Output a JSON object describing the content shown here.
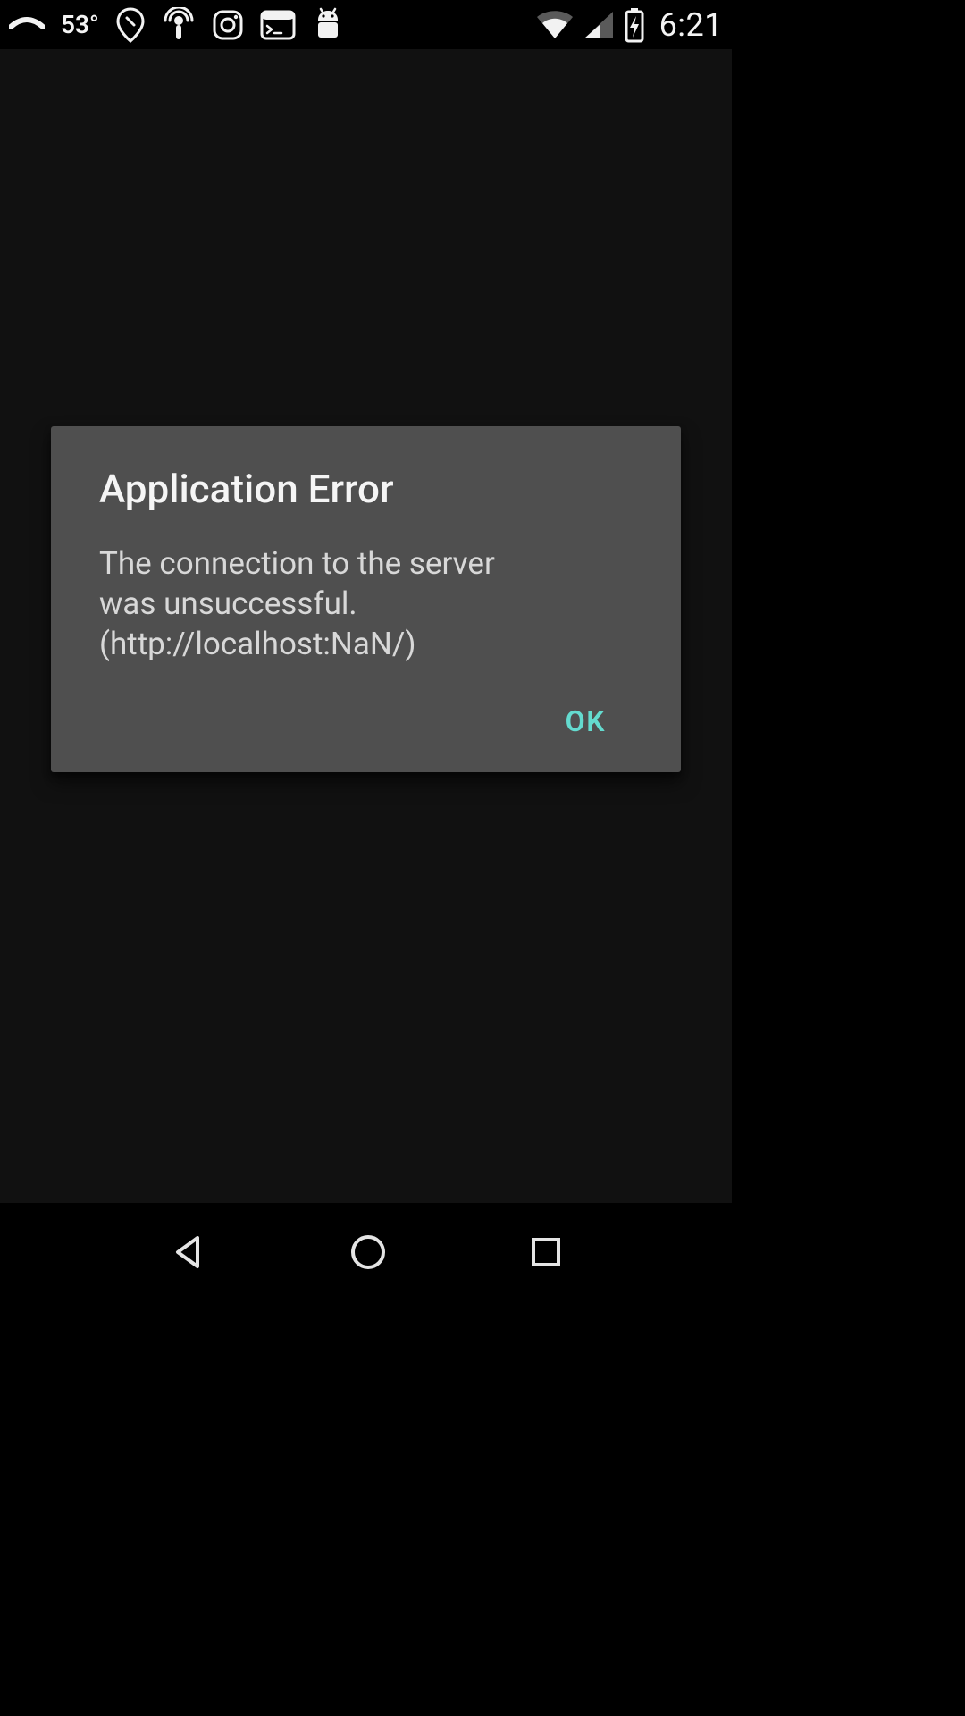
{
  "status_bar": {
    "temperature": "53°",
    "time": "6:21",
    "icons": {
      "signal_arc": "signal-arc-icon",
      "location": "location-icon",
      "podcast": "podcast-icon",
      "instagram": "instagram-icon",
      "terminal": "terminal-icon",
      "android": "android-icon",
      "wifi": "wifi-icon",
      "cell": "cell-signal-icon",
      "battery": "battery-charging-icon"
    }
  },
  "dialog": {
    "title": "Application Error",
    "message": "The connection to the server was unsuccessful. (http://localhost:NaN/)",
    "ok_label": "OK"
  },
  "nav_bar": {
    "back": "back",
    "home": "home",
    "recents": "recents"
  },
  "colors": {
    "accent": "#64dbcf",
    "dialog_bg": "#4f4f4f",
    "app_bg": "#111111"
  }
}
